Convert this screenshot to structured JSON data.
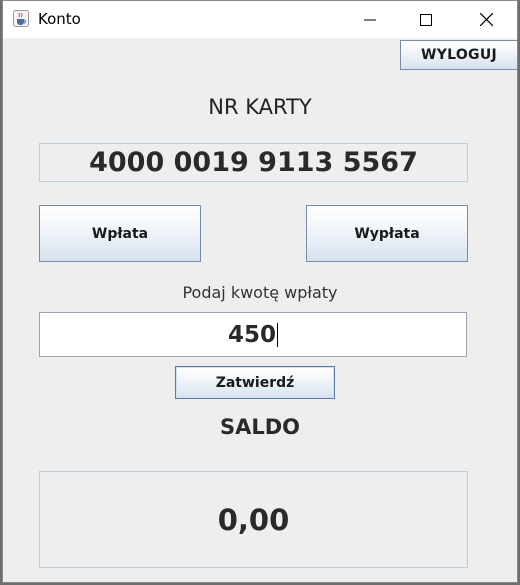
{
  "window": {
    "title": "Konto",
    "icon": "java-cup-icon"
  },
  "controls": {
    "minimize_icon": "minimize-icon",
    "maximize_icon": "maximize-icon",
    "close_icon": "close-icon"
  },
  "header": {
    "logout_label": "WYLOGUJ"
  },
  "card": {
    "label": "NR KARTY",
    "number": "4000 0019 9113 5567"
  },
  "actions": {
    "deposit_label": "Wpłata",
    "withdraw_label": "Wypłata"
  },
  "amount": {
    "prompt": "Podaj kwotę wpłaty",
    "value": "450",
    "confirm_label": "Zatwierdź"
  },
  "balance": {
    "label": "SALDO",
    "value": "0,00"
  }
}
